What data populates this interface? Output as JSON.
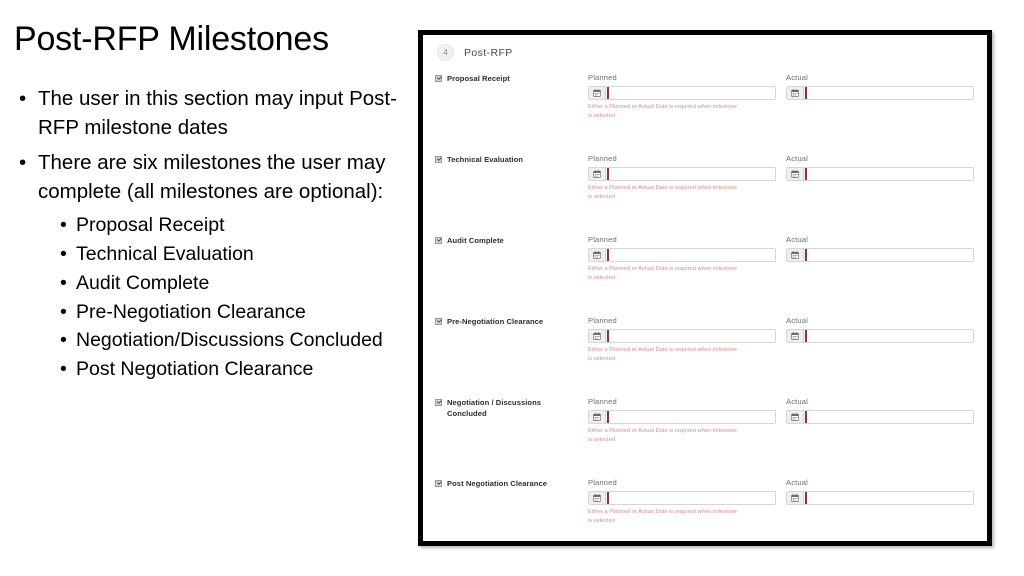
{
  "slide": {
    "title": "Post-RFP Milestones",
    "bullets": [
      {
        "level": 1,
        "text": "The user in this section may input Post-RFP milestone dates"
      },
      {
        "level": 1,
        "text": "There are six milestones the user may complete (all milestones are optional):"
      },
      {
        "level": 2,
        "text": "Proposal Receipt"
      },
      {
        "level": 2,
        "text": "Technical Evaluation"
      },
      {
        "level": 2,
        "text": "Audit Complete"
      },
      {
        "level": 2,
        "text": "Pre-Negotiation Clearance"
      },
      {
        "level": 2,
        "text": "Negotiation/Discussions Concluded"
      },
      {
        "level": 2,
        "text": "Post Negotiation Clearance"
      }
    ],
    "bullet_glyph": "•"
  },
  "form": {
    "section": {
      "step_number": "4",
      "title": "Post-RFP"
    },
    "column_labels": {
      "planned": "Planned",
      "actual": "Actual"
    },
    "error_message": "Either a Planned or Actual Date is required when milestone is selected",
    "calendar_icon": "calendar-icon",
    "colors": {
      "error_text": "#e08a8a",
      "caret_bar": "#a12b2b",
      "frame_border": "#000000",
      "label_text": "#6f6f6f"
    },
    "rows": [
      {
        "name": "Proposal Receipt",
        "checked": true,
        "planned_value": "",
        "actual_value": "",
        "has_error": true
      },
      {
        "name": "Technical Evaluation",
        "checked": true,
        "planned_value": "",
        "actual_value": "",
        "has_error": true
      },
      {
        "name": "Audit Complete",
        "checked": true,
        "planned_value": "",
        "actual_value": "",
        "has_error": true
      },
      {
        "name": "Pre-Negotiation Clearance",
        "checked": true,
        "planned_value": "",
        "actual_value": "",
        "has_error": true
      },
      {
        "name": "Negotiation / Discussions Concluded",
        "checked": true,
        "planned_value": "",
        "actual_value": "",
        "has_error": true
      },
      {
        "name": "Post Negotiation Clearance",
        "checked": true,
        "planned_value": "",
        "actual_value": "",
        "has_error": true
      }
    ]
  }
}
